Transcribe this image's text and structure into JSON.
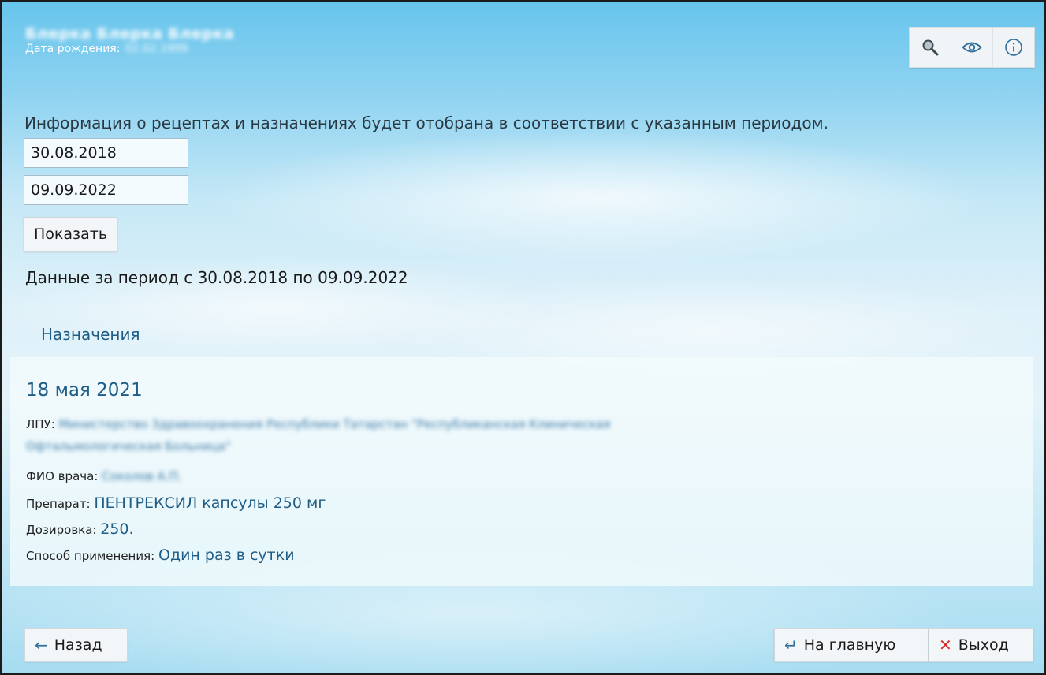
{
  "header": {
    "patient_name": "Блерка Блерка Блерка",
    "dob_label": "Дата рождения:",
    "dob_value": "02.02.1999"
  },
  "toolbar": {
    "icons": [
      "search-icon",
      "eye-icon",
      "info-icon"
    ]
  },
  "filter": {
    "info_text": "Информация о рецептах и назначениях будет отобрана в соответствии с указанным периодом.",
    "date_from": "30.08.2018",
    "date_to": "09.09.2022",
    "show_button": "Показать",
    "period_text": "Данные за период с 30.08.2018 по 09.09.2022"
  },
  "section_tab": "Назначения",
  "prescription": {
    "date": "18 мая 2021",
    "lpu_label": "ЛПУ:",
    "lpu_value_line1": "Министерство Здравоохранения Республики Татарстан \"Республиканская Клиническая",
    "lpu_value_line2": "Офтальмологическая Больница\"",
    "doctor_label": "ФИО врача:",
    "doctor_value": "Соколов А.П.",
    "drug_label": "Препарат:",
    "drug_value": "ПЕНТРЕКСИЛ капсулы 250 мг",
    "dose_label": "Дозировка:",
    "dose_value": "250.",
    "method_label": "Способ применения:",
    "method_value": "Один раз в сутки"
  },
  "footer": {
    "back_label": "Назад",
    "home_label": "На главную",
    "exit_label": "Выход"
  },
  "colors": {
    "accent": "#1f5d86",
    "exit_icon": "#d62c2c"
  }
}
